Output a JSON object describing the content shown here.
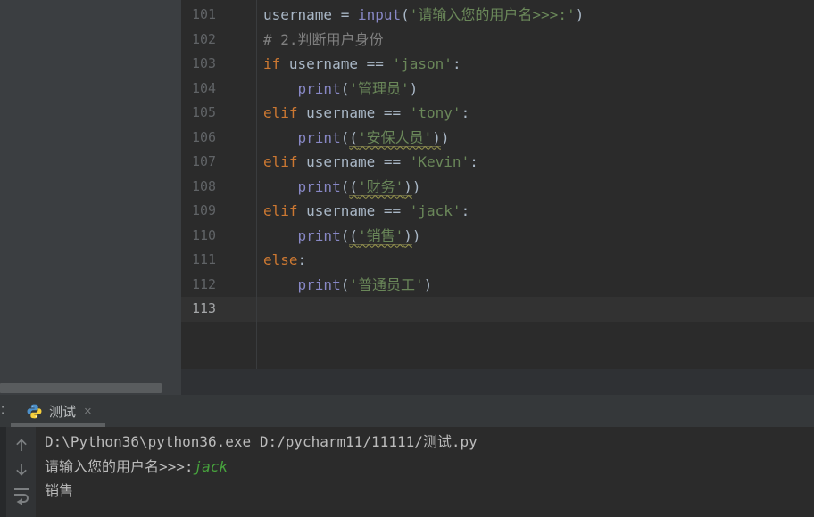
{
  "app": {
    "name": "PyCharm",
    "theme": "Darcula"
  },
  "colors": {
    "editor_bg": "#2b2b2b",
    "panel_bg": "#3b3e41",
    "active_line_bg": "#323232",
    "keyword": "#cc7832",
    "string": "#6a8759",
    "builtin": "#8888c6",
    "comment": "#808080",
    "default_text": "#a9b7c6",
    "line_number": "#606366",
    "console_text": "#bbbbbb",
    "user_input_green": "#47a33d",
    "warning_underline": "#9c9a4e"
  },
  "editor": {
    "active_line": "113",
    "lines": [
      {
        "num": "101",
        "segments": [
          [
            "username = ",
            "plain"
          ],
          [
            "input",
            "builtin"
          ],
          [
            "(",
            "plain"
          ],
          [
            "'请输入您的用户名>>>:'",
            "str"
          ],
          [
            ")",
            "plain"
          ]
        ]
      },
      {
        "num": "102",
        "segments": [
          [
            "# 2.判断用户身份",
            "com"
          ]
        ]
      },
      {
        "num": "103",
        "segments": [
          [
            "if",
            "kw"
          ],
          [
            " username == ",
            "plain"
          ],
          [
            "'jason'",
            "str"
          ],
          [
            ":",
            "plain"
          ]
        ]
      },
      {
        "num": "104",
        "segments": [
          [
            "    ",
            "plain"
          ],
          [
            "print",
            "builtin"
          ],
          [
            "(",
            "plain"
          ],
          [
            "'管理员'",
            "str"
          ],
          [
            ")",
            "plain"
          ]
        ]
      },
      {
        "num": "105",
        "segments": [
          [
            "elif",
            "kw"
          ],
          [
            " username == ",
            "plain"
          ],
          [
            "'tony'",
            "str"
          ],
          [
            ":",
            "plain"
          ]
        ]
      },
      {
        "num": "106",
        "segments": [
          [
            "    ",
            "plain"
          ],
          [
            "print",
            "builtin"
          ],
          [
            "(",
            "plain"
          ],
          [
            "(",
            "plain",
            1
          ],
          [
            "'安保人员'",
            "str",
            1
          ],
          [
            ")",
            "plain",
            1
          ],
          [
            ")",
            "plain"
          ]
        ]
      },
      {
        "num": "107",
        "segments": [
          [
            "elif",
            "kw"
          ],
          [
            " username == ",
            "plain"
          ],
          [
            "'Kevin'",
            "str"
          ],
          [
            ":",
            "plain"
          ]
        ]
      },
      {
        "num": "108",
        "segments": [
          [
            "    ",
            "plain"
          ],
          [
            "print",
            "builtin"
          ],
          [
            "(",
            "plain"
          ],
          [
            "(",
            "plain",
            1
          ],
          [
            "'财务'",
            "str",
            1
          ],
          [
            ")",
            "plain",
            1
          ],
          [
            ")",
            "plain"
          ]
        ]
      },
      {
        "num": "109",
        "segments": [
          [
            "elif",
            "kw"
          ],
          [
            " username == ",
            "plain"
          ],
          [
            "'jack'",
            "str"
          ],
          [
            ":",
            "plain"
          ]
        ]
      },
      {
        "num": "110",
        "segments": [
          [
            "    ",
            "plain"
          ],
          [
            "print",
            "builtin"
          ],
          [
            "(",
            "plain"
          ],
          [
            "(",
            "plain",
            1
          ],
          [
            "'销售'",
            "str",
            1
          ],
          [
            ")",
            "plain",
            1
          ],
          [
            ")",
            "plain"
          ]
        ]
      },
      {
        "num": "111",
        "segments": [
          [
            "else",
            "kw"
          ],
          [
            ":",
            "plain"
          ]
        ]
      },
      {
        "num": "112",
        "segments": [
          [
            "    ",
            "plain"
          ],
          [
            "print",
            "builtin"
          ],
          [
            "(",
            "plain"
          ],
          [
            "'普通员工'",
            "str"
          ],
          [
            ")",
            "plain"
          ]
        ]
      },
      {
        "num": "113",
        "segments": []
      }
    ]
  },
  "console": {
    "run_window_label": ":",
    "tab": {
      "label": "测试",
      "icon": "python-icon",
      "close_glyph": "×"
    },
    "toolbar_icons": [
      "arrow-up-icon",
      "arrow-down-icon",
      "soft-wrap-icon"
    ],
    "output": [
      {
        "segments": [
          [
            "D:\\Python36\\python36.exe D:/pycharm11/11111/测试.py",
            "plain"
          ]
        ]
      },
      {
        "segments": [
          [
            "请输入您的用户名>>>:",
            "plain"
          ],
          [
            "jack",
            "input"
          ]
        ]
      },
      {
        "segments": [
          [
            "销售",
            "plain"
          ]
        ]
      }
    ]
  }
}
